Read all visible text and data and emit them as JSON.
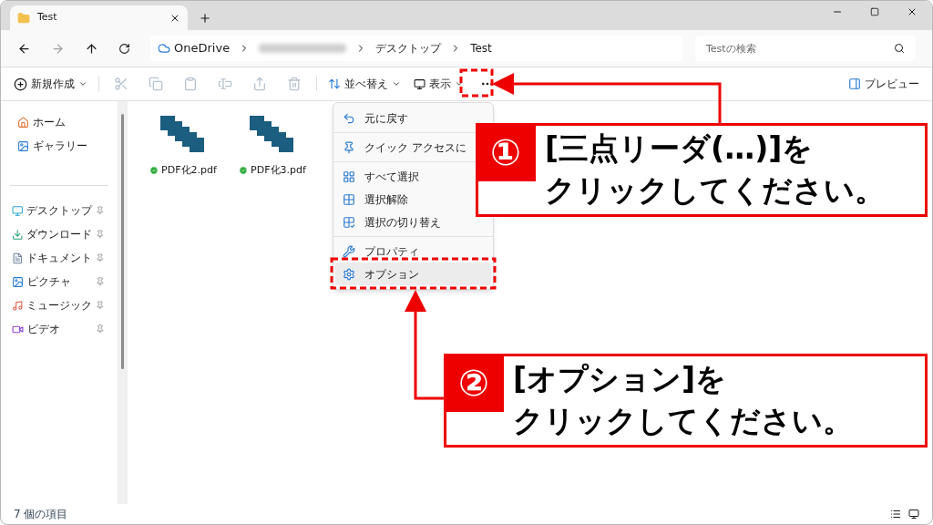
{
  "window": {
    "tab_title": "Test"
  },
  "address": {
    "segments": [
      {
        "kind": "cloud",
        "label": "OneDrive"
      },
      {
        "kind": "blurred"
      },
      {
        "kind": "text",
        "label": "デスクトップ"
      },
      {
        "kind": "text",
        "label": "Test"
      }
    ]
  },
  "search": {
    "placeholder": "Testの検索"
  },
  "toolbar": {
    "new_label": "新規作成",
    "actions": [
      {
        "kind": "cut",
        "disabled": true
      },
      {
        "kind": "copy",
        "disabled": true
      },
      {
        "kind": "paste",
        "disabled": true
      },
      {
        "kind": "rename",
        "disabled": true
      },
      {
        "kind": "share",
        "disabled": true
      },
      {
        "kind": "delete",
        "disabled": true
      }
    ],
    "sort_label": "並べ替え",
    "view_label": "表示",
    "preview_label": "プレビュー"
  },
  "sidebar": {
    "sections": [
      [
        {
          "kind": "home",
          "label": "ホーム",
          "pinned": false
        },
        {
          "kind": "gallery",
          "label": "ギャラリー",
          "pinned": false
        }
      ],
      [
        {
          "kind": "desktop",
          "label": "デスクトップ",
          "pinned": true
        },
        {
          "kind": "download",
          "label": "ダウンロード",
          "pinned": true
        },
        {
          "kind": "document",
          "label": "ドキュメント",
          "pinned": true
        },
        {
          "kind": "picture",
          "label": "ピクチャ",
          "pinned": true
        },
        {
          "kind": "music",
          "label": "ミュージック",
          "pinned": true
        },
        {
          "kind": "video",
          "label": "ビデオ",
          "pinned": true
        }
      ]
    ]
  },
  "files": [
    {
      "name": "PDF化2.pdf",
      "synced": true
    },
    {
      "name": "PDF化3.pdf",
      "synced": true
    }
  ],
  "menu": [
    {
      "kind": "undo",
      "label": "元に戻す",
      "selected": false
    },
    {
      "kind": "divider"
    },
    {
      "kind": "pin",
      "label": "クイック アクセスに",
      "selected": false
    },
    {
      "kind": "divider"
    },
    {
      "kind": "select-all",
      "label": "すべて選択",
      "selected": false
    },
    {
      "kind": "select-none",
      "label": "選択解除",
      "selected": false
    },
    {
      "kind": "invert",
      "label": "選択の切り替え",
      "selected": false
    },
    {
      "kind": "divider"
    },
    {
      "kind": "properties",
      "label": "プロパティ",
      "selected": false
    },
    {
      "kind": "options",
      "label": "オプション",
      "selected": true
    }
  ],
  "status_bar": {
    "count": "7 個の項目"
  },
  "callouts": [
    {
      "number": "①",
      "lines": [
        "[三点リーダ(…)]を",
        "クリックしてください。"
      ]
    },
    {
      "number": "②",
      "lines": [
        "[オプション]を",
        "クリックしてください。"
      ]
    }
  ]
}
